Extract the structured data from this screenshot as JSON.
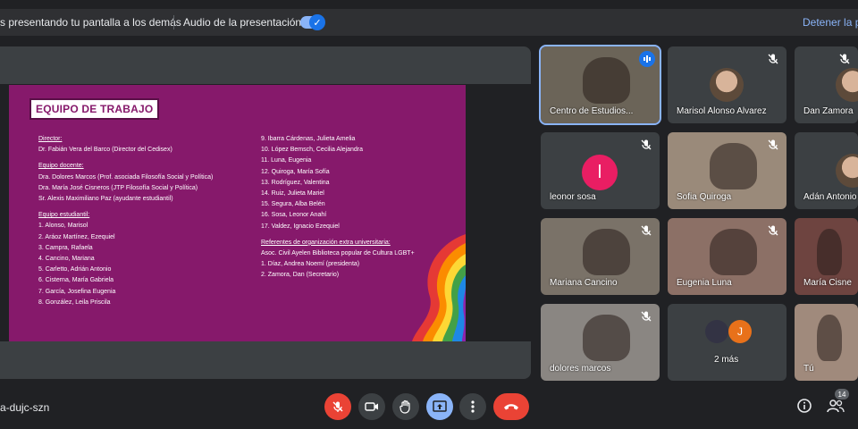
{
  "sharebar": {
    "message": "s presentando tu pantalla a los demás",
    "audio_label": "Audio de la presentación",
    "stop_label": "Detener la pr"
  },
  "slide": {
    "title": "EQUIPO DE TRABAJO",
    "left_column": [
      {
        "text": "Director:",
        "heading": true
      },
      {
        "text": "Dr. Fabián Vera del Barco (Director del Cedisex)",
        "heading": false
      },
      {
        "text": "",
        "gap": true
      },
      {
        "text": "Equipo docente:",
        "heading": true
      },
      {
        "text": "Dra. Dolores Marcos (Prof. asociada Filosofía Social y Política)",
        "heading": false
      },
      {
        "text": "Dra. María José Cisneros (JTP Filosofía Social y Política)",
        "heading": false
      },
      {
        "text": "Sr. Alexis Maximiliano Paz (ayudante estudiantil)",
        "heading": false
      },
      {
        "text": "",
        "gap": true
      },
      {
        "text": "Equipo estudiantil:",
        "heading": true
      },
      {
        "text": "1. Alonso, Marisol",
        "heading": false
      },
      {
        "text": "2. Aráoz Martínez, Ezequiel",
        "heading": false
      },
      {
        "text": "3. Campra, Rafaela",
        "heading": false
      },
      {
        "text": "4. Cancino, Mariana",
        "heading": false
      },
      {
        "text": "5. Carletto, Adrián Antonio",
        "heading": false
      },
      {
        "text": "6. Cisterna, María Gabriela",
        "heading": false
      },
      {
        "text": "7. García, Josefina Eugenia",
        "heading": false
      },
      {
        "text": "8. González, Leila Priscila",
        "heading": false
      }
    ],
    "right_column": [
      {
        "text": "9. Ibarra Cárdenas, Julieta Amelia",
        "heading": false
      },
      {
        "text": "10. López Bemsch, Cecilia Alejandra",
        "heading": false
      },
      {
        "text": "11. Luna, Eugenia",
        "heading": false
      },
      {
        "text": "12. Quiroga, María Sofía",
        "heading": false
      },
      {
        "text": "13. Rodríguez, Valentina",
        "heading": false
      },
      {
        "text": "14. Ruiz, Julieta Mariel",
        "heading": false
      },
      {
        "text": "15. Segura, Alba Belén",
        "heading": false
      },
      {
        "text": "16. Sosa, Leonor Anahí",
        "heading": false
      },
      {
        "text": "17. Valdez, Ignacio Ezequiel",
        "heading": false
      },
      {
        "text": "",
        "gap": true
      },
      {
        "text": "Referentes de organización extra universitaria:",
        "heading": true
      },
      {
        "text": "Asoc. Civil Ayelen Biblioteca popular de Cultura LGBT+",
        "heading": false
      },
      {
        "text": "1. Díaz, Andrea Noemí (presidenta)",
        "heading": false
      },
      {
        "text": "2. Zamora, Dan (Secretario)",
        "heading": false
      }
    ]
  },
  "participants": [
    {
      "name": "Centro de Estudios...",
      "muted": false,
      "speaking": true,
      "bg": "#6b6458"
    },
    {
      "name": "Marisol Alonso Alvarez",
      "muted": true,
      "speaking": false,
      "bg": "#3c4043",
      "avatar": "photo"
    },
    {
      "name": "Dan Zamora",
      "muted": true,
      "speaking": false,
      "bg": "#3c4043",
      "avatar": "photo"
    },
    {
      "name": "leonor sosa",
      "muted": true,
      "speaking": false,
      "bg": "#3c4043",
      "initial": "l",
      "initial_color": "#e91e63"
    },
    {
      "name": "Sofia Quiroga",
      "muted": true,
      "speaking": false,
      "bg": "#9a8a7a"
    },
    {
      "name": "Adán Antonio",
      "muted": false,
      "speaking": false,
      "bg": "#3c4043",
      "avatar": "photo"
    },
    {
      "name": "Mariana Cancino",
      "muted": true,
      "speaking": false,
      "bg": "#7a7268"
    },
    {
      "name": "Eugenia Luna",
      "muted": true,
      "speaking": false,
      "bg": "#8c7066"
    },
    {
      "name": "María Cisne",
      "muted": false,
      "speaking": false,
      "bg": "#6e4440"
    },
    {
      "name": "dolores marcos",
      "muted": true,
      "speaking": false,
      "bg": "#8a8682"
    },
    {
      "name": "2 más",
      "muted": false,
      "speaking": false,
      "bg": "#3c4043",
      "more_initial": "J"
    },
    {
      "name": "Tú",
      "muted": false,
      "speaking": false,
      "bg": "#a08a7c"
    }
  ],
  "bottombar": {
    "meeting_code": "a-dujc-szn",
    "people_count": "14"
  },
  "colors": {
    "accent": "#8ab4f8",
    "danger": "#ea4335",
    "slide_bg": "#86196b"
  }
}
